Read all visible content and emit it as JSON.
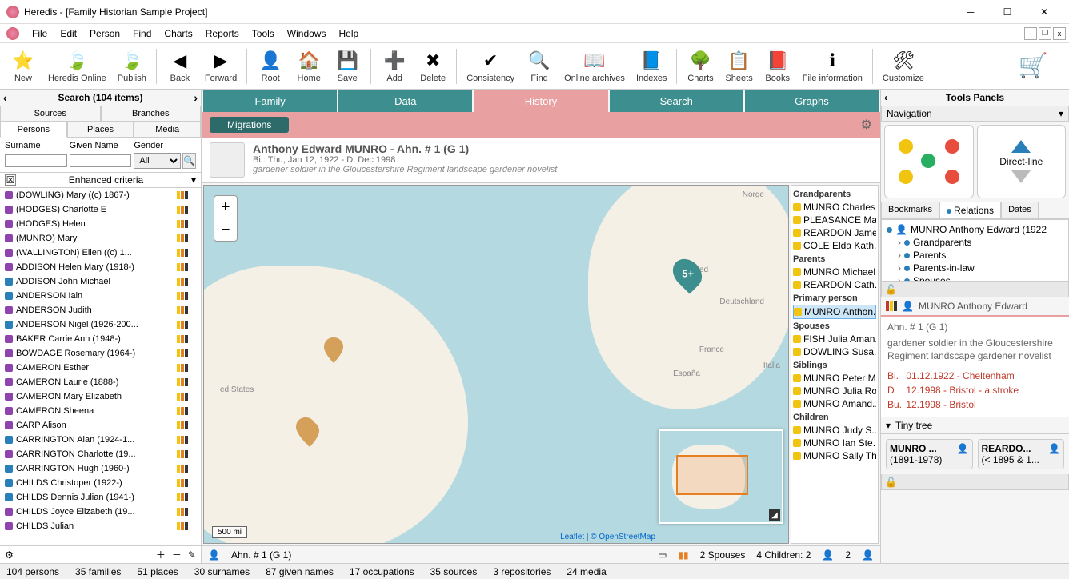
{
  "window": {
    "title": "Heredis - [Family Historian Sample Project]"
  },
  "menu": [
    "File",
    "Edit",
    "Person",
    "Find",
    "Charts",
    "Reports",
    "Tools",
    "Windows",
    "Help"
  ],
  "toolbar": [
    {
      "label": "New"
    },
    {
      "label": "Heredis Online"
    },
    {
      "label": "Publish"
    },
    {
      "sep": true
    },
    {
      "label": "Back"
    },
    {
      "label": "Forward"
    },
    {
      "sep": true
    },
    {
      "label": "Root"
    },
    {
      "label": "Home"
    },
    {
      "label": "Save"
    },
    {
      "sep": true
    },
    {
      "label": "Add"
    },
    {
      "label": "Delete"
    },
    {
      "sep": true
    },
    {
      "label": "Consistency"
    },
    {
      "label": "Find"
    },
    {
      "label": "Online archives"
    },
    {
      "label": "Indexes"
    },
    {
      "sep": true
    },
    {
      "label": "Charts"
    },
    {
      "label": "Sheets"
    },
    {
      "label": "Books"
    },
    {
      "label": "File information"
    },
    {
      "sep": true
    },
    {
      "label": "Customize"
    }
  ],
  "search_header": "Search (104 items)",
  "search_tabs_top": [
    "Sources",
    "Branches"
  ],
  "search_tabs_bottom": [
    "Persons",
    "Places",
    "Media"
  ],
  "search_form": {
    "surname": "Surname",
    "given": "Given Name",
    "gender": "Gender",
    "gender_value": "All"
  },
  "enhanced": "Enhanced criteria",
  "persons": [
    "(DOWLING) Mary ((c) 1867-)",
    "(HODGES) Charlotte E",
    "(HODGES) Helen",
    "(MUNRO) Mary",
    "(WALLINGTON) Ellen ((c) 1...",
    "ADDISON Helen Mary (1918-)",
    "ADDISON John Michael",
    "ANDERSON Iain",
    "ANDERSON Judith",
    "ANDERSON Nigel (1926-200...",
    "BAKER Carrie Ann (1948-)",
    "BOWDAGE Rosemary (1964-)",
    "CAMERON Esther",
    "CAMERON Laurie (1888-)",
    "CAMERON Mary Elizabeth",
    "CAMERON Sheena",
    "CARP Alison",
    "CARRINGTON Alan (1924-1...",
    "CARRINGTON Charlotte (19...",
    "CARRINGTON Hugh (1960-)",
    "CHILDS Christoper (1922-)",
    "CHILDS Dennis Julian (1941-)",
    "CHILDS Joyce Elizabeth (19...",
    "CHILDS Julian"
  ],
  "view_tabs": [
    "Family",
    "Data",
    "History",
    "Search",
    "Graphs"
  ],
  "pink_pill": "Migrations",
  "person": {
    "name": "Anthony Edward MUNRO - Ahn. #  1 (G 1)",
    "dates": "Bi.: Thu, Jan 12, 1922 - D: Dec 1998",
    "occup": "gardener soldier in the Gloucestershire Regiment landscape gardener novelist"
  },
  "map": {
    "scale": "500 mi",
    "attrib": "Leaflet | © OpenStreetMap",
    "cluster": "5+",
    "labels": {
      "us": "ed States",
      "uk": "United",
      "de": "Deutschland",
      "fr": "France",
      "es": "España",
      "it": "Italia",
      "no": "Norge"
    }
  },
  "relations": {
    "Grandparents": [
      "MUNRO Charles...",
      "PLEASANCE Ma...",
      "REARDON Jame...",
      "COLE Elda Kath..."
    ],
    "Parents": [
      "MUNRO Michael...",
      "REARDON Cath..."
    ],
    "Primary person": [
      "MUNRO Anthon..."
    ],
    "Spouses": [
      "FISH Julia Aman...",
      "DOWLING Susa..."
    ],
    "Siblings": [
      "MUNRO Peter M...",
      "MUNRO Julia Ro...",
      "MUNRO Amand..."
    ],
    "Children": [
      "MUNRO Judy S...",
      "MUNRO Ian Ste...",
      "MUNRO Sally Th..."
    ]
  },
  "primary_label": "Primary person",
  "center_footer": {
    "ahn": "Ahn. #  1 (G 1)",
    "spouses": "2 Spouses",
    "children": "4 Children: 2",
    "childicon": "2"
  },
  "tools_header": "Tools Panels",
  "nav": {
    "title": "Navigation",
    "direct": "Direct-line"
  },
  "rtabs": [
    "Bookmarks",
    "Relations",
    "Dates"
  ],
  "tree": [
    {
      "label": "MUNRO Anthony Edward (1922",
      "indent": 0,
      "icon": "person"
    },
    {
      "label": "Grandparents",
      "indent": 1,
      "expand": true
    },
    {
      "label": "Parents",
      "indent": 1,
      "expand": true
    },
    {
      "label": "Parents-in-law",
      "indent": 1,
      "expand": true
    },
    {
      "label": "Spouses",
      "indent": 1,
      "expand": true
    }
  ],
  "info": {
    "name": "MUNRO Anthony Edward",
    "ahn": "Ahn. # 1 (G 1)",
    "occup": "gardener soldier in the Gloucestershire Regiment landscape gardener novelist",
    "events": [
      {
        "k": "Bi.",
        "v": "01.12.1922 - Cheltenham"
      },
      {
        "k": "D",
        "v": "12.1998 - Bristol - a stroke"
      },
      {
        "k": "Bu.",
        "v": "12.1998 - Bristol"
      }
    ],
    "tiny": "Tiny tree",
    "cards": [
      {
        "n": "MUNRO ...",
        "y": "(1891-1978)"
      },
      {
        "n": "REARDO...",
        "y": "(< 1895 & 1..."
      }
    ]
  },
  "status": [
    "104  persons",
    "35  families",
    "51  places",
    "30  surnames",
    "87  given names",
    "17  occupations",
    "35  sources",
    "3  repositories",
    "24   media"
  ]
}
